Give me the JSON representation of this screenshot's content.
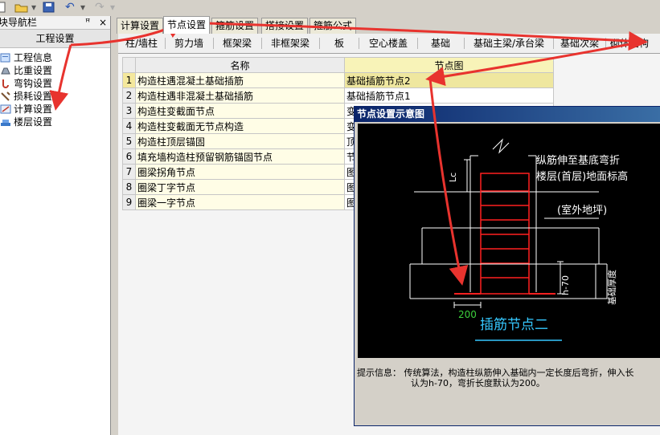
{
  "toolbar": {
    "undo_icon": "undo-icon",
    "redo_icon": "redo-icon"
  },
  "nav": {
    "title": "块导航栏",
    "pin": "ꟸ",
    "close": "×",
    "group": "工程设置",
    "items": [
      {
        "label": "工程信息",
        "icon": "info-icon"
      },
      {
        "label": "比重设置",
        "icon": "weight-icon"
      },
      {
        "label": "弯钩设置",
        "icon": "hook-icon"
      },
      {
        "label": "损耗设置",
        "icon": "loss-icon"
      },
      {
        "label": "计算设置",
        "icon": "calculator-icon"
      },
      {
        "label": "楼层设置",
        "icon": "floor-icon"
      }
    ]
  },
  "tabs": [
    "计算设置",
    "节点设置",
    "箍筋设置",
    "搭接设置",
    "箍筋公式"
  ],
  "active_tab": "节点设置",
  "subtabs": [
    "柱/墙柱",
    "剪力墙",
    "框架梁",
    "非框架梁",
    "板",
    "空心楼盖",
    "基础",
    "基础主梁/承台梁",
    "基础次梁",
    "砌体结构"
  ],
  "grid": {
    "headers": {
      "name": "名称",
      "node": "节点图"
    },
    "rows": [
      {
        "no": "1",
        "name": "构造柱遇混凝土基础插筋",
        "node": "基础插筋节点2"
      },
      {
        "no": "2",
        "name": "构造柱遇非混凝土基础插筋",
        "node": "基础插筋节点1"
      },
      {
        "no": "3",
        "name": "构造柱变截面节点",
        "node": "变"
      },
      {
        "no": "4",
        "name": "构造柱变截面无节点构造",
        "node": "变"
      },
      {
        "no": "5",
        "name": "构造柱顶层锚固",
        "node": "顶"
      },
      {
        "no": "6",
        "name": "填充墙构造柱预留钢筋锚固节点",
        "node": "节"
      },
      {
        "no": "7",
        "name": "圈梁拐角节点",
        "node": "图"
      },
      {
        "no": "8",
        "name": "圈梁丁字节点",
        "node": "图"
      },
      {
        "no": "9",
        "name": "圈梁一字节点",
        "node": "图"
      }
    ]
  },
  "dialog": {
    "title": "节点设置示意图",
    "diagram": {
      "note1": "纵筋伸至基底弯折",
      "note2": "楼层(首层)地面标高",
      "note3": "(室外地坪)",
      "lc": "Lc",
      "h70": "h-70",
      "thickness": "基础厚度",
      "dim": "200",
      "caption": "插筋节点二"
    },
    "info_label": "提示信息：",
    "info_text": "传统算法，构造柱纵筋伸入基础内一定长度后弯折，伸入长",
    "info_text2": "认为h-70，弯折长度默认为200。"
  }
}
